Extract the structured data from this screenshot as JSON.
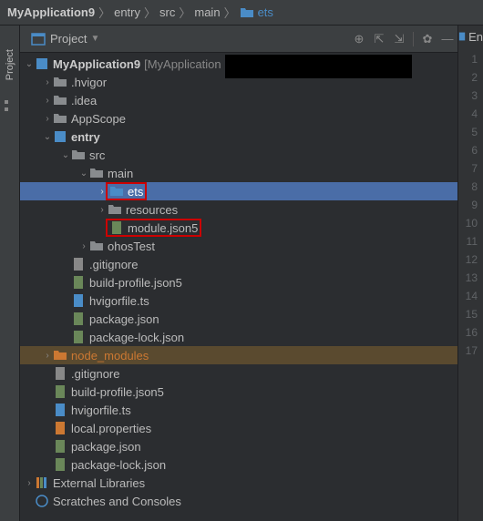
{
  "breadcrumb": {
    "root": "MyApplication9",
    "parts": [
      "entry",
      "src",
      "main",
      "ets"
    ]
  },
  "project_view": {
    "label": "Project"
  },
  "side_label": "Project",
  "tree": {
    "root_name": "MyApplication9",
    "root_suffix": "[MyApplication",
    "hvigor": ".hvigor",
    "idea": ".idea",
    "appscope": "AppScope",
    "entry": "entry",
    "src": "src",
    "main": "main",
    "ets": "ets",
    "resources": "resources",
    "modulejson": "module.json5",
    "ohostest": "ohosTest",
    "gitignore": ".gitignore",
    "buildprofile": "build-profile.json5",
    "hvigorfile": "hvigorfile.ts",
    "packagejson": "package.json",
    "packagelock": "package-lock.json",
    "nodemodules": "node_modules",
    "gitignore2": ".gitignore",
    "buildprofile2": "build-profile.json5",
    "hvigorfile2": "hvigorfile.ts",
    "localprops": "local.properties",
    "packagejson2": "package.json",
    "packagelock2": "package-lock.json",
    "extlib": "External Libraries",
    "scratches": "Scratches and Consoles"
  },
  "gutter": {
    "tab_label": "En",
    "lines": [
      "1",
      "2",
      "3",
      "4",
      "5",
      "6",
      "7",
      "8",
      "9",
      "10",
      "11",
      "12",
      "13",
      "14",
      "15",
      "16",
      "17"
    ]
  }
}
